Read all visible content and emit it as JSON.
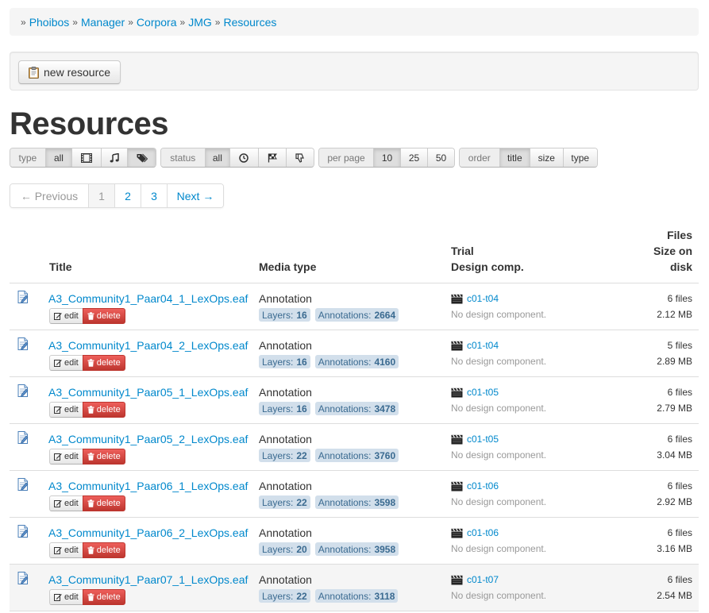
{
  "breadcrumb": [
    "Phoibos",
    "Manager",
    "Corpora",
    "JMG",
    "Resources"
  ],
  "toolbar": {
    "new_resource_label": "new resource"
  },
  "page_title": "Resources",
  "filters": {
    "type": {
      "label": "type",
      "all": "all"
    },
    "status": {
      "label": "status",
      "all": "all"
    },
    "per_page": {
      "label": "per page",
      "options": [
        "10",
        "25",
        "50"
      ]
    },
    "order": {
      "label": "order",
      "options": [
        "title",
        "size",
        "type"
      ]
    }
  },
  "pagination": {
    "previous": "← Previous",
    "pages": [
      "1",
      "2",
      "3"
    ],
    "next": "Next →"
  },
  "table": {
    "headers": {
      "title": "Title",
      "media_type": "Media type",
      "trial": "Trial",
      "design": "Design comp.",
      "files": "Files",
      "size_on": "Size on",
      "disk": "disk"
    },
    "edit_label": "edit",
    "delete_label": "delete",
    "layers_label": "Layers:",
    "annotations_label": "Annotations:",
    "rows": [
      {
        "title": "A3_Community1_Paar04_1_LexOps.eaf",
        "media": "Annotation",
        "layers": "16",
        "annotations": "2664",
        "trial": "c01-t04",
        "design": "No design component.",
        "files": "6 files",
        "size": "2.12 MB"
      },
      {
        "title": "A3_Community1_Paar04_2_LexOps.eaf",
        "media": "Annotation",
        "layers": "16",
        "annotations": "4160",
        "trial": "c01-t04",
        "design": "No design component.",
        "files": "5 files",
        "size": "2.89 MB"
      },
      {
        "title": "A3_Community1_Paar05_1_LexOps.eaf",
        "media": "Annotation",
        "layers": "16",
        "annotations": "3478",
        "trial": "c01-t05",
        "design": "No design component.",
        "files": "6 files",
        "size": "2.79 MB"
      },
      {
        "title": "A3_Community1_Paar05_2_LexOps.eaf",
        "media": "Annotation",
        "layers": "22",
        "annotations": "3760",
        "trial": "c01-t05",
        "design": "No design component.",
        "files": "6 files",
        "size": "3.04 MB"
      },
      {
        "title": "A3_Community1_Paar06_1_LexOps.eaf",
        "media": "Annotation",
        "layers": "22",
        "annotations": "3598",
        "trial": "c01-t06",
        "design": "No design component.",
        "files": "6 files",
        "size": "2.92 MB"
      },
      {
        "title": "A3_Community1_Paar06_2_LexOps.eaf",
        "media": "Annotation",
        "layers": "20",
        "annotations": "3958",
        "trial": "c01-t06",
        "design": "No design component.",
        "files": "6 files",
        "size": "3.16 MB"
      },
      {
        "title": "A3_Community1_Paar07_1_LexOps.eaf",
        "media": "Annotation",
        "layers": "22",
        "annotations": "3118",
        "trial": "c01-t07",
        "design": "No design component.",
        "files": "6 files",
        "size": "2.54 MB"
      }
    ]
  }
}
